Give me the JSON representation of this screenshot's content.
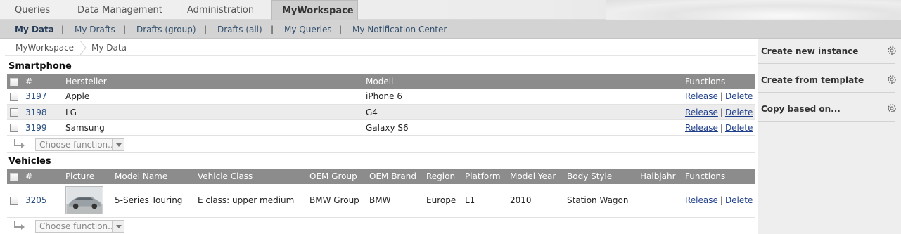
{
  "top_tabs": [
    {
      "label": "Queries"
    },
    {
      "label": "Data Management"
    },
    {
      "label": "Administration"
    },
    {
      "label": "MyWorkspace"
    }
  ],
  "sub_nav": [
    {
      "label": "My Data"
    },
    {
      "label": "My Drafts"
    },
    {
      "label": "Drafts (group)"
    },
    {
      "label": "Drafts (all)"
    },
    {
      "label": "My Queries"
    },
    {
      "label": "My Notification Center"
    }
  ],
  "sub_nav_separator": "|",
  "breadcrumb": [
    "MyWorkspace",
    "My Data"
  ],
  "smartphone": {
    "title": "Smartphone",
    "columns": {
      "num": "#",
      "hersteller": "Hersteller",
      "modell": "Modell",
      "functions": "Functions"
    },
    "rows": [
      {
        "id": "3197",
        "hersteller": "Apple",
        "modell": "iPhone 6"
      },
      {
        "id": "3198",
        "hersteller": "LG",
        "modell": "G4"
      },
      {
        "id": "3199",
        "hersteller": "Samsung",
        "modell": "Galaxy S6"
      }
    ],
    "function_placeholder": "Choose function..."
  },
  "vehicles": {
    "title": "Vehicles",
    "columns": {
      "num": "#",
      "picture": "Picture",
      "model_name": "Model Name",
      "vehicle_class": "Vehicle Class",
      "oem_group": "OEM Group",
      "oem_brand": "OEM Brand",
      "region": "Region",
      "platform": "Platform",
      "model_year": "Model Year",
      "body_style": "Body Style",
      "halbjahr": "Halbjahr",
      "functions": "Functions"
    },
    "rows": [
      {
        "id": "3205",
        "model_name": "5-Series Touring",
        "vehicle_class": "E class: upper medium",
        "oem_group": "BMW Group",
        "oem_brand": "BMW",
        "region": "Europe",
        "platform": "L1",
        "model_year": "2010",
        "body_style": "Station Wagon",
        "halbjahr": ""
      }
    ],
    "function_placeholder": "Choose function..."
  },
  "row_actions": {
    "release": "Release",
    "delete": "Delete",
    "separator": "|"
  },
  "sidebar": [
    {
      "label": "Create new instance"
    },
    {
      "label": "Create from template"
    },
    {
      "label": "Copy based on..."
    }
  ],
  "colors": {
    "header_gray": "#8c8c8c",
    "link_blue": "#1f3f8a",
    "id_blue": "#2b4f7e"
  }
}
